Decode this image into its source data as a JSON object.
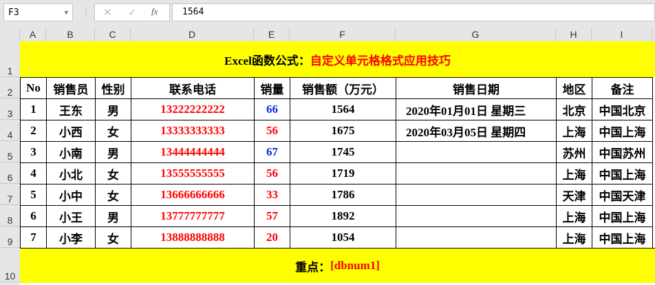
{
  "formula_bar": {
    "name_box": "F3",
    "formula": "1564",
    "cancel_icon": "✕",
    "enter_icon": "✓",
    "fx_icon": "fx"
  },
  "columns": [
    "A",
    "B",
    "C",
    "D",
    "E",
    "F",
    "G",
    "H",
    "I"
  ],
  "rows": [
    "1",
    "2",
    "3",
    "4",
    "5",
    "6",
    "7",
    "8",
    "9",
    "10"
  ],
  "title": {
    "prefix": "Excel函数公式：",
    "main": "自定义单元格格式应用技巧"
  },
  "headers": [
    "No",
    "销售员",
    "性别",
    "联系电话",
    "销量",
    "销售额（万元）",
    "销售日期",
    "地区",
    "备注"
  ],
  "data": [
    [
      "1",
      "王东",
      "男",
      "13222222222",
      "66",
      "1564",
      "2020年01月01日  星期三",
      "北京",
      "中国北京"
    ],
    [
      "2",
      "小西",
      "女",
      "13333333333",
      "56",
      "1675",
      "2020年03月05日  星期四",
      "上海",
      "中国上海"
    ],
    [
      "3",
      "小南",
      "男",
      "13444444444",
      "67",
      "1745",
      "",
      "苏州",
      "中国苏州"
    ],
    [
      "4",
      "小北",
      "女",
      "13555555555",
      "56",
      "1719",
      "",
      "上海",
      "中国上海"
    ],
    [
      "5",
      "小中",
      "女",
      "13666666666",
      "33",
      "1786",
      "",
      "天津",
      "中国天津"
    ],
    [
      "6",
      "小王",
      "男",
      "13777777777",
      "57",
      "1892",
      "",
      "上海",
      "中国上海"
    ],
    [
      "7",
      "小李",
      "女",
      "13888888888",
      "20",
      "1054",
      "",
      "上海",
      "中国上海"
    ]
  ],
  "sales_colors": [
    "blue",
    "red",
    "blue",
    "red",
    "red",
    "red",
    "red"
  ],
  "footer": {
    "prefix": "重点：",
    "main": "[dbnum1]"
  },
  "colors": {
    "band": "#ffff00",
    "red": "#ff0000",
    "blue": "#0033cc"
  }
}
